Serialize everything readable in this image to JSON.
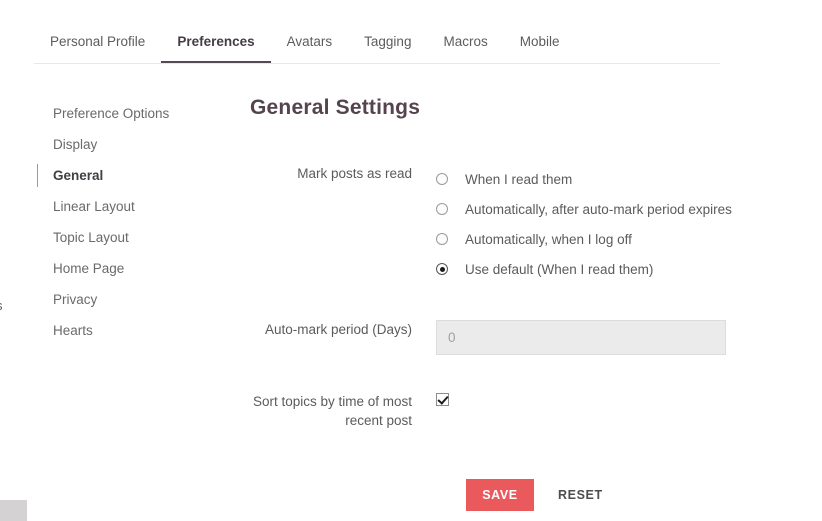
{
  "tabs": [
    {
      "label": "Personal Profile",
      "active": false
    },
    {
      "label": "Preferences",
      "active": true
    },
    {
      "label": "Avatars",
      "active": false
    },
    {
      "label": "Tagging",
      "active": false
    },
    {
      "label": "Macros",
      "active": false
    },
    {
      "label": "Mobile",
      "active": false
    }
  ],
  "sidebar": {
    "items": [
      {
        "label": "Preference Options",
        "active": false
      },
      {
        "label": "Display",
        "active": false
      },
      {
        "label": "General",
        "active": true
      },
      {
        "label": "Linear Layout",
        "active": false
      },
      {
        "label": "Topic Layout",
        "active": false
      },
      {
        "label": "Home Page",
        "active": false
      },
      {
        "label": "Privacy",
        "active": false
      },
      {
        "label": "Hearts",
        "active": false
      }
    ]
  },
  "panel": {
    "title": "General Settings",
    "mark_posts": {
      "label": "Mark posts as read",
      "options": [
        {
          "label": "When I read them",
          "checked": false
        },
        {
          "label": "Automatically, after auto-mark period expires",
          "checked": false
        },
        {
          "label": "Automatically, when I log off",
          "checked": false
        },
        {
          "label": "Use default (When I read them)",
          "checked": true
        }
      ]
    },
    "auto_mark": {
      "label": "Auto-mark period (Days)",
      "value": "",
      "placeholder": "0"
    },
    "sort_topics": {
      "label": "Sort topics by time of most recent post",
      "checked": true
    },
    "save_label": "SAVE",
    "reset_label": "RESET"
  },
  "fragments": {
    "left_clip": "s"
  },
  "colors": {
    "accent_red": "#ea5a5d",
    "title": "#55434e",
    "active_tab_underline": "#574a54",
    "input_bg": "#ebebeb",
    "corner_block": "#d4d2d2"
  }
}
